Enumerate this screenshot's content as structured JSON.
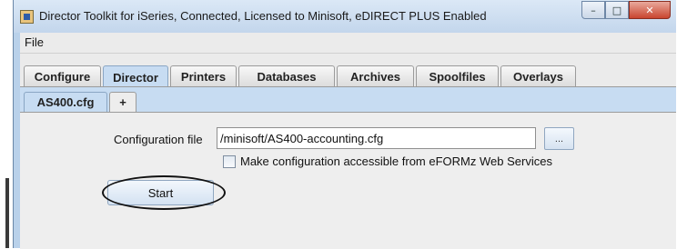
{
  "window": {
    "title": "Director Toolkit for iSeries, Connected, Licensed to Minisoft, eDIRECT PLUS Enabled",
    "icon": "app-icon",
    "controls": {
      "minimize": "–",
      "maximize": "□",
      "close": "✕"
    }
  },
  "menu": {
    "file": "File"
  },
  "tabs": [
    "Configure",
    "Director",
    "Printers",
    "Databases",
    "Archives",
    "Spoolfiles",
    "Overlays"
  ],
  "active_tab": "Director",
  "subtabs": {
    "file_tab": "AS400.cfg",
    "add_tab": "+"
  },
  "form": {
    "config_label": "Configuration file",
    "config_value": "/minisoft/AS400-accounting.cfg",
    "browse_label": "...",
    "checkbox_label": "Make configuration accessible from eFORMz Web Services",
    "checkbox_checked": false,
    "start_label": "Start"
  },
  "colors": {
    "accent": "#c7dcf2",
    "titlebar": "#c3d6ec",
    "close": "#c9452f"
  }
}
